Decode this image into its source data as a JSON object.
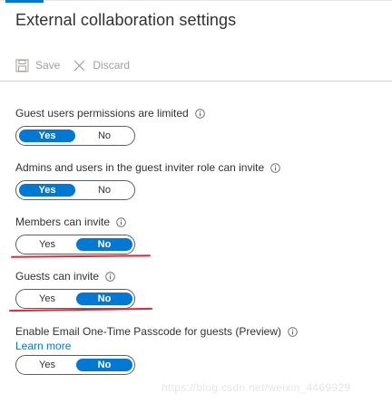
{
  "page": {
    "title": "External collaboration settings"
  },
  "toolbar": {
    "save_label": "Save",
    "discard_label": "Discard"
  },
  "settings": [
    {
      "label": "Guest users permissions are limited",
      "yes": "Yes",
      "no": "No",
      "selected": "yes",
      "learn_more": ""
    },
    {
      "label": "Admins and users in the guest inviter role can invite",
      "yes": "Yes",
      "no": "No",
      "selected": "yes",
      "learn_more": ""
    },
    {
      "label": "Members can invite",
      "yes": "Yes",
      "no": "No",
      "selected": "no",
      "learn_more": ""
    },
    {
      "label": "Guests can invite",
      "yes": "Yes",
      "no": "No",
      "selected": "no",
      "learn_more": ""
    },
    {
      "label": "Enable Email One-Time Passcode for guests (Preview)",
      "yes": "Yes",
      "no": "No",
      "selected": "no",
      "learn_more": "Learn more"
    }
  ],
  "watermark": "https://blog.csdn.net/weixin_4469929",
  "colors": {
    "accent": "#0078d4",
    "annotation": "#e0283a",
    "disabled_text": "#a19f9d"
  },
  "icons": {
    "save": "save-icon",
    "discard": "close-icon",
    "info": "info-icon"
  }
}
